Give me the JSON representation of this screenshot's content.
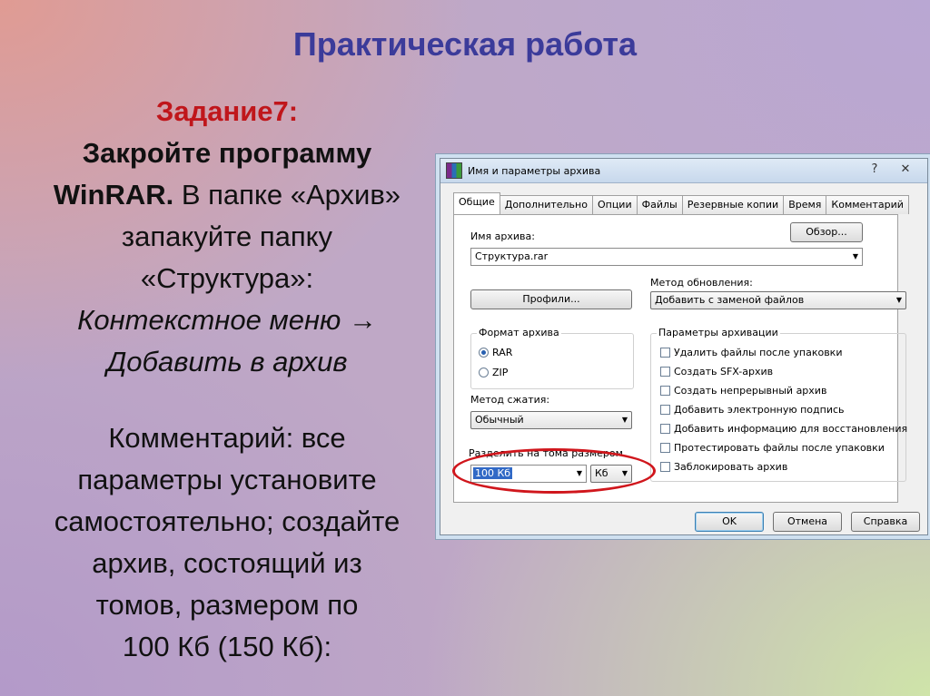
{
  "slide": {
    "title": "Практическая работа",
    "task_number": "Задание7:",
    "task_line1": "Закройте программу",
    "task_winrar": "WinRAR.",
    "task_line2": " В папке «Архив»",
    "task_line3": "запакуйте папку",
    "task_line4": "«Структура»:",
    "task_italic1": "Контекстное меню →",
    "task_italic2": "Добавить в архив",
    "comment_line1": "Комментарий: все",
    "comment_line2": "параметры установите",
    "comment_line3": "самостоятельно; создайте",
    "comment_line4": "архив, состоящий из",
    "comment_line5": "томов, размером по",
    "comment_line6": "100 Кб (150 Кб):"
  },
  "dialog": {
    "title": "Имя и параметры архива",
    "help_glyph": "?",
    "close_glyph": "✕",
    "tabs": [
      {
        "label": "Общие"
      },
      {
        "label": "Дополнительно"
      },
      {
        "label": "Опции"
      },
      {
        "label": "Файлы"
      },
      {
        "label": "Резервные копии"
      },
      {
        "label": "Время"
      },
      {
        "label": "Комментарий"
      }
    ],
    "archive_name_label": "Имя архива:",
    "browse_button": "Обзор...",
    "archive_name_value": "Структура.rar",
    "update_method_label": "Метод обновления:",
    "update_method_value": "Добавить с заменой файлов",
    "profiles_button": "Профили...",
    "format_group": "Формат архива",
    "format_rar": "RAR",
    "format_zip": "ZIP",
    "compression_label": "Метод сжатия:",
    "compression_value": "Обычный",
    "volume_label": "Разделить на тома размером",
    "volume_value": "100 Кб",
    "volume_unit": "Кб",
    "options_group": "Параметры архивации",
    "options": [
      {
        "label": "Удалить файлы после упаковки"
      },
      {
        "label": "Создать SFX-архив"
      },
      {
        "label": "Создать непрерывный архив"
      },
      {
        "label": "Добавить электронную подпись"
      },
      {
        "label": "Добавить информацию для восстановления"
      },
      {
        "label": "Протестировать файлы после упаковки"
      },
      {
        "label": "Заблокировать архив"
      }
    ],
    "ok_button": "OK",
    "cancel_button": "Отмена",
    "help_button": "Справка",
    "dropdown_arrow": "▼"
  },
  "colors": {
    "title": "#3b3b9a",
    "task_number": "#c0161b",
    "highlight_ellipse": "#d0161c"
  }
}
